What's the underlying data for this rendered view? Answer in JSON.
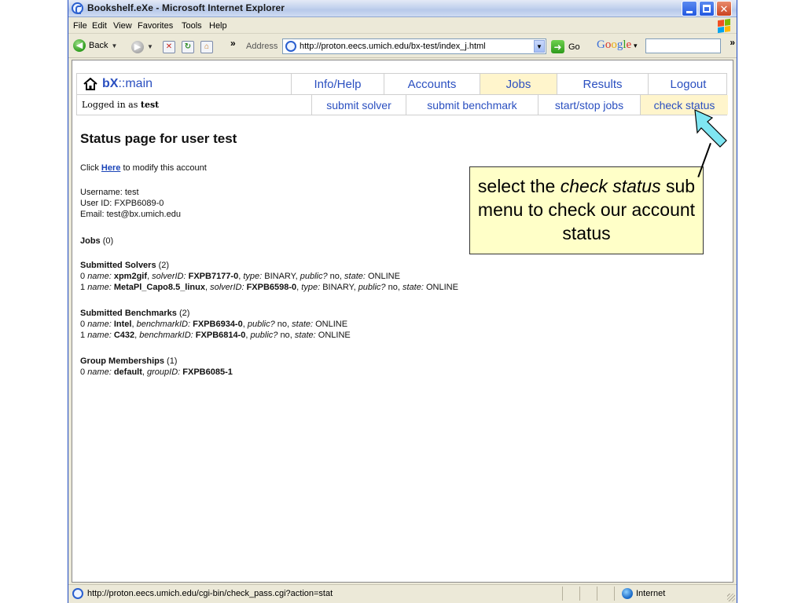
{
  "window": {
    "title": "Bookshelf.eXe - Microsoft Internet Explorer"
  },
  "menubar": {
    "items": [
      "File",
      "Edit",
      "View",
      "Favorites",
      "Tools",
      "Help"
    ]
  },
  "toolbar": {
    "back_label": "Back",
    "address_label": "Address",
    "url": "http://proton.eecs.umich.edu/bx-test/index_j.html",
    "go_label": "Go",
    "search_brand": "Google",
    "search_value": ""
  },
  "nav": {
    "brand_bold": "bX",
    "brand_rest": "::main",
    "items": [
      "Info/Help",
      "Accounts",
      "Jobs",
      "Results",
      "Logout"
    ],
    "active_item": "Jobs",
    "logged_in_prefix": "Logged in as",
    "logged_in_user": "test",
    "sub_items": [
      "submit solver",
      "submit benchmark",
      "start/stop jobs",
      "check status"
    ],
    "active_sub_item": "check status"
  },
  "content": {
    "title": "Status page for user test",
    "modify_prefix": "Click",
    "modify_link": "Here",
    "modify_suffix": "to modify this account",
    "username": "Username: test",
    "user_id": "User ID: FXPB6089-0",
    "email": "Email: test@bx.umich.edu",
    "jobs_heading": "Jobs",
    "jobs_count": "(0)",
    "solvers_heading": "Submitted Solvers",
    "solvers_count": "(2)",
    "solvers": [
      {
        "idx": "0",
        "name": "xpm2gif",
        "id": "FXPB7177-0",
        "type": "BINARY",
        "public": "no",
        "state": "ONLINE"
      },
      {
        "idx": "1",
        "name": "MetaPl_Capo8.5_linux",
        "id": "FXPB6598-0",
        "type": "BINARY",
        "public": "no",
        "state": "ONLINE"
      }
    ],
    "benchmarks_heading": "Submitted Benchmarks",
    "benchmarks_count": "(2)",
    "benchmarks": [
      {
        "idx": "0",
        "name": "Intel",
        "id": "FXPB6934-0",
        "public": "no",
        "state": "ONLINE"
      },
      {
        "idx": "1",
        "name": "C432",
        "id": "FXPB6814-0",
        "public": "no",
        "state": "ONLINE"
      }
    ],
    "groups_heading": "Group Memberships",
    "groups_count": "(1)",
    "groups": [
      {
        "idx": "0",
        "name": "default",
        "id": "FXPB6085-1"
      }
    ]
  },
  "labels": {
    "name": "name:",
    "solver_id": "solverID:",
    "benchmark_id": "benchmarkID:",
    "group_id": "groupID:",
    "type": "type:",
    "public": "public?",
    "state": "state:"
  },
  "callout": {
    "pre": "select the",
    "em": "check status",
    "post": "sub menu to check our account status"
  },
  "statusbar": {
    "text": "http://proton.eecs.umich.edu/cgi-bin/check_pass.cgi?action=stat",
    "zone": "Internet"
  },
  "colors": {
    "link_blue": "#2a4fc0",
    "active_tab_bg": "#fff5cc",
    "callout_bg": "#ffffc8",
    "arrow_fill": "#7fe6f2"
  }
}
